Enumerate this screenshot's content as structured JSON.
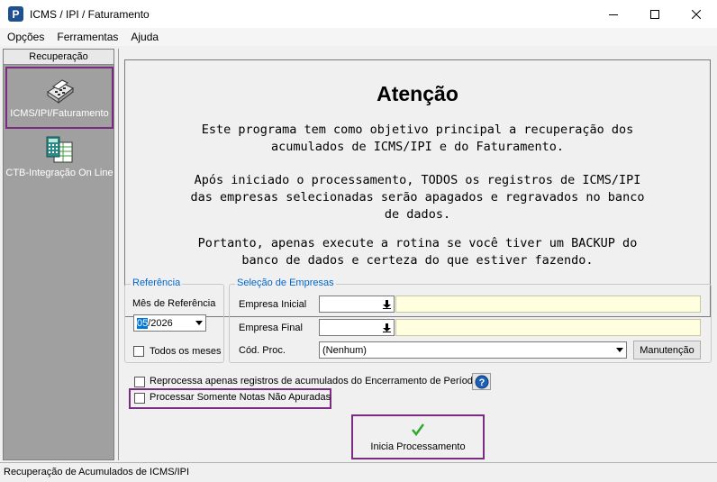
{
  "window": {
    "title": "ICMS / IPI / Faturamento",
    "icon_letter": "P",
    "controls": {
      "minimize": "—",
      "maximize": "☐",
      "close": "✕"
    }
  },
  "menu": [
    "Opções",
    "Ferramentas",
    "Ajuda"
  ],
  "sidebar": {
    "header": "Recuperação",
    "items": [
      {
        "label": "ICMS/IPI/Faturamento",
        "icon": "cash-register-icon",
        "selected": true
      },
      {
        "label": "CTB-Integração On Line",
        "icon": "calculator-sheet-icon",
        "selected": false
      }
    ]
  },
  "notice": {
    "title": "Atenção",
    "paragraphs": [
      "Este programa tem como objetivo principal a recuperação dos\nacumulados de ICMS/IPI e do Faturamento.",
      "Após iniciado o processamento, TODOS os registros de ICMS/IPI\ndas empresas selecionadas serão apagados e regravados no banco\nde dados.",
      "Portanto, apenas execute a rotina se você tiver um BACKUP do\nbanco de dados e certeza do que estiver fazendo."
    ]
  },
  "referencia": {
    "legend": "Referência",
    "mes_label": "Mês de Referência",
    "mes_month": "05",
    "mes_year": "/2026",
    "todos_label": "Todos os meses",
    "todos_checked": false
  },
  "empresas": {
    "legend": "Seleção de Empresas",
    "inicial_label": "Empresa Inicial",
    "inicial_value": "",
    "final_label": "Empresa Final",
    "final_value": "",
    "cod_proc_label": "Cód. Proc.",
    "cod_proc_value": "(Nenhum)",
    "manutencao_label": "Manutenção"
  },
  "options": {
    "reprocessa_label": "Reprocessa apenas registros de acumulados do Encerramento de Período",
    "reprocessa_checked": false,
    "somente_label": "Processar Somente Notas Não Apuradas",
    "somente_checked": false
  },
  "action": {
    "inicia_label": "Inicia Processamento"
  },
  "status": {
    "text": "Recuperação de Acumulados de ICMS/IPI"
  },
  "colors": {
    "highlight": "#7b2c82",
    "legend": "#0066cc",
    "sidebar": "#a0a0a0",
    "yellow_field": "#ffffe0"
  }
}
